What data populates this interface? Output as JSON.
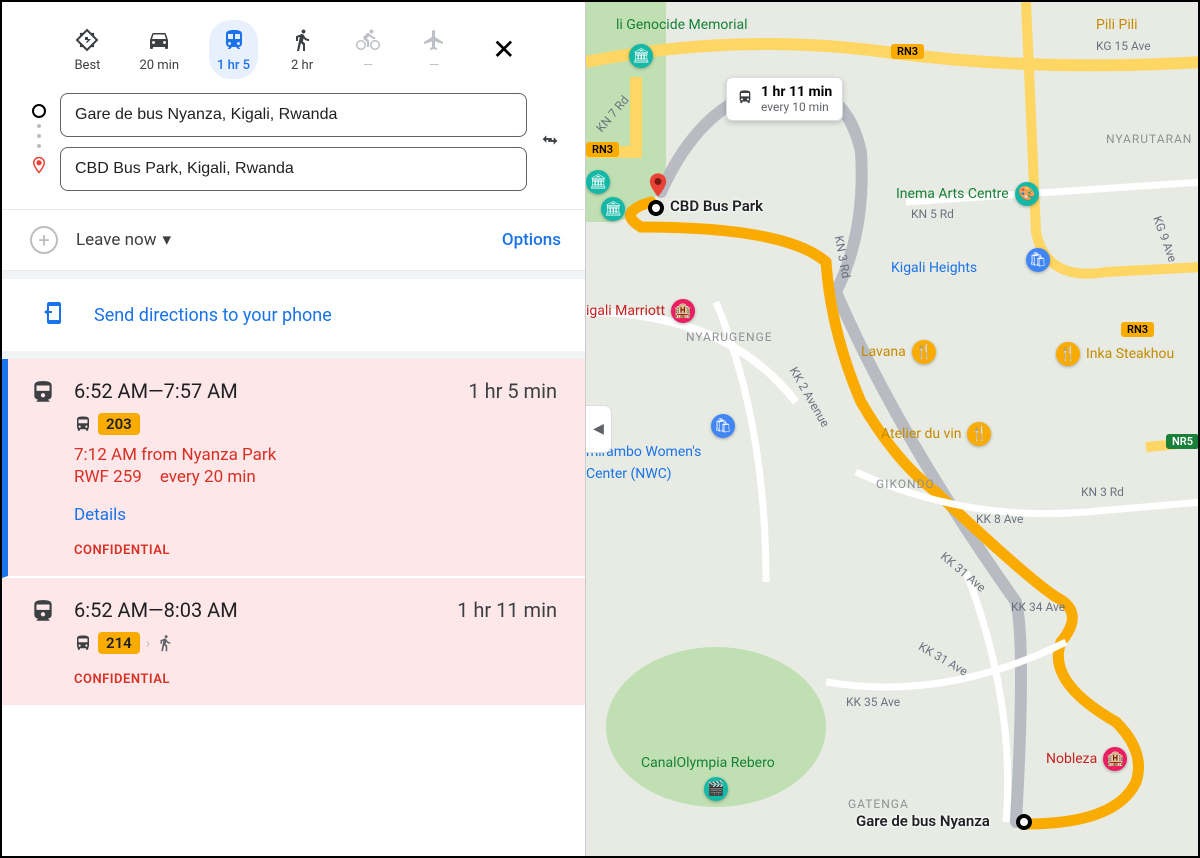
{
  "modes": {
    "best": "Best",
    "car": "20 min",
    "transit": "1 hr 5",
    "walk": "2 hr",
    "bike": "—",
    "plane": "—"
  },
  "origin": "Gare de bus Nyanza, Kigali, Rwanda",
  "destination": "CBD Bus Park, Kigali, Rwanda",
  "leave_label": "Leave now",
  "options_label": "Options",
  "send_label": "Send directions to your phone",
  "routes": [
    {
      "span": "6:52 AM—7:57 AM",
      "duration": "1 hr 5 min",
      "bus_number": "203",
      "from": "7:12 AM from Nyanza Park",
      "fare": "RWF 259",
      "frequency": "every 20 min",
      "details": "Details",
      "confidential": "CONFIDENTIAL",
      "has_walk": false
    },
    {
      "span": "6:52 AM—8:03 AM",
      "duration": "1 hr 11 min",
      "bus_number": "214",
      "confidential": "CONFIDENTIAL",
      "has_walk": true
    }
  ],
  "map": {
    "bubble_time": "1 hr 11 min",
    "bubble_freq": "every 10 min",
    "dest_label": "CBD Bus Park",
    "origin_label": "Gare de bus Nyanza",
    "pois": {
      "genocide": "li Genocide Memorial",
      "inema": "Inema Arts Centre",
      "heights": "Kigali Heights",
      "marriott": "igali Marriott",
      "nwc1": "mirambo Women's",
      "nwc2": "Center (NWC)",
      "lavana": "Lavana",
      "inka": "Inka Steakhou",
      "atelier": "Atelier du vin",
      "canal": "CanalOlympia Rebero",
      "nobleza": "Nobleza",
      "pili": "Pili Pili"
    },
    "hoods": {
      "nyarugenge": "NYARUGENGE",
      "gikondo": "GIKONDO",
      "gatenga": "GATENGA",
      "nyarutaran": "NYARUTARAN"
    },
    "roads": {
      "kg15": "KG 15 Ave",
      "kn3": "KN 3 Rd",
      "kn3b": "KN 3 Rd",
      "kn5": "KN 5 Rd",
      "kn7": "KN 7 Rd",
      "kn9": "KG 9 Ave",
      "kk2": "KK 2 Avenue",
      "kk8": "KK 8 Ave",
      "kk31": "KK 31 Ave",
      "kk31b": "KK 31 Ave",
      "kk34": "KK 34 Ave",
      "kk35": "KK 35 Ave"
    },
    "shields": {
      "rn3a": "RN3",
      "rn3b": "RN3",
      "rn3c": "RN3",
      "nr5": "NR5"
    }
  }
}
